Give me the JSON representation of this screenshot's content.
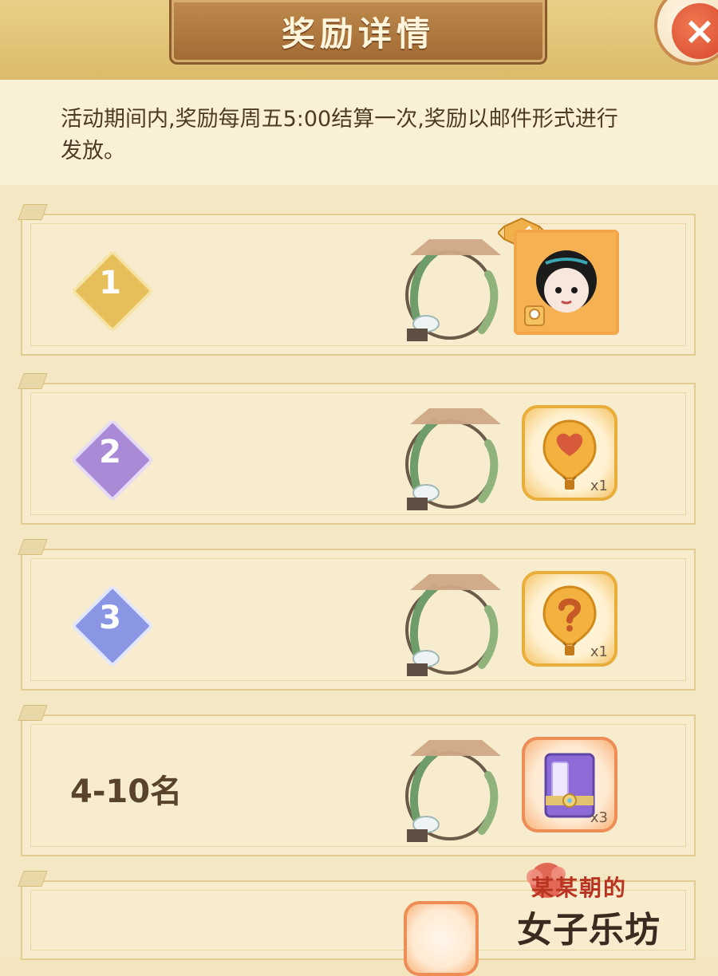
{
  "header": {
    "title": "奖励详情",
    "close_label": "×"
  },
  "notice": {
    "text": "活动期间内,奖励每周五5:00结算一次,奖励以邮件形式进行发放。"
  },
  "rewards": [
    {
      "rank": "1",
      "rank_color": "#e6bf5a",
      "items": [
        {
          "type": "portrait",
          "badge": "金"
        }
      ]
    },
    {
      "rank": "2",
      "rank_color": "#a98ad6",
      "items": [
        {
          "type": "balloon-heart",
          "count": "x1"
        }
      ]
    },
    {
      "rank": "3",
      "rank_color": "#8a96e3",
      "items": [
        {
          "type": "balloon-question",
          "count": "x1"
        }
      ]
    },
    {
      "rank": "4-10名",
      "items": [
        {
          "type": "book",
          "count": "x3"
        }
      ]
    }
  ],
  "watermark": {
    "line1": "某某朝的",
    "line2": "女子乐坊"
  }
}
